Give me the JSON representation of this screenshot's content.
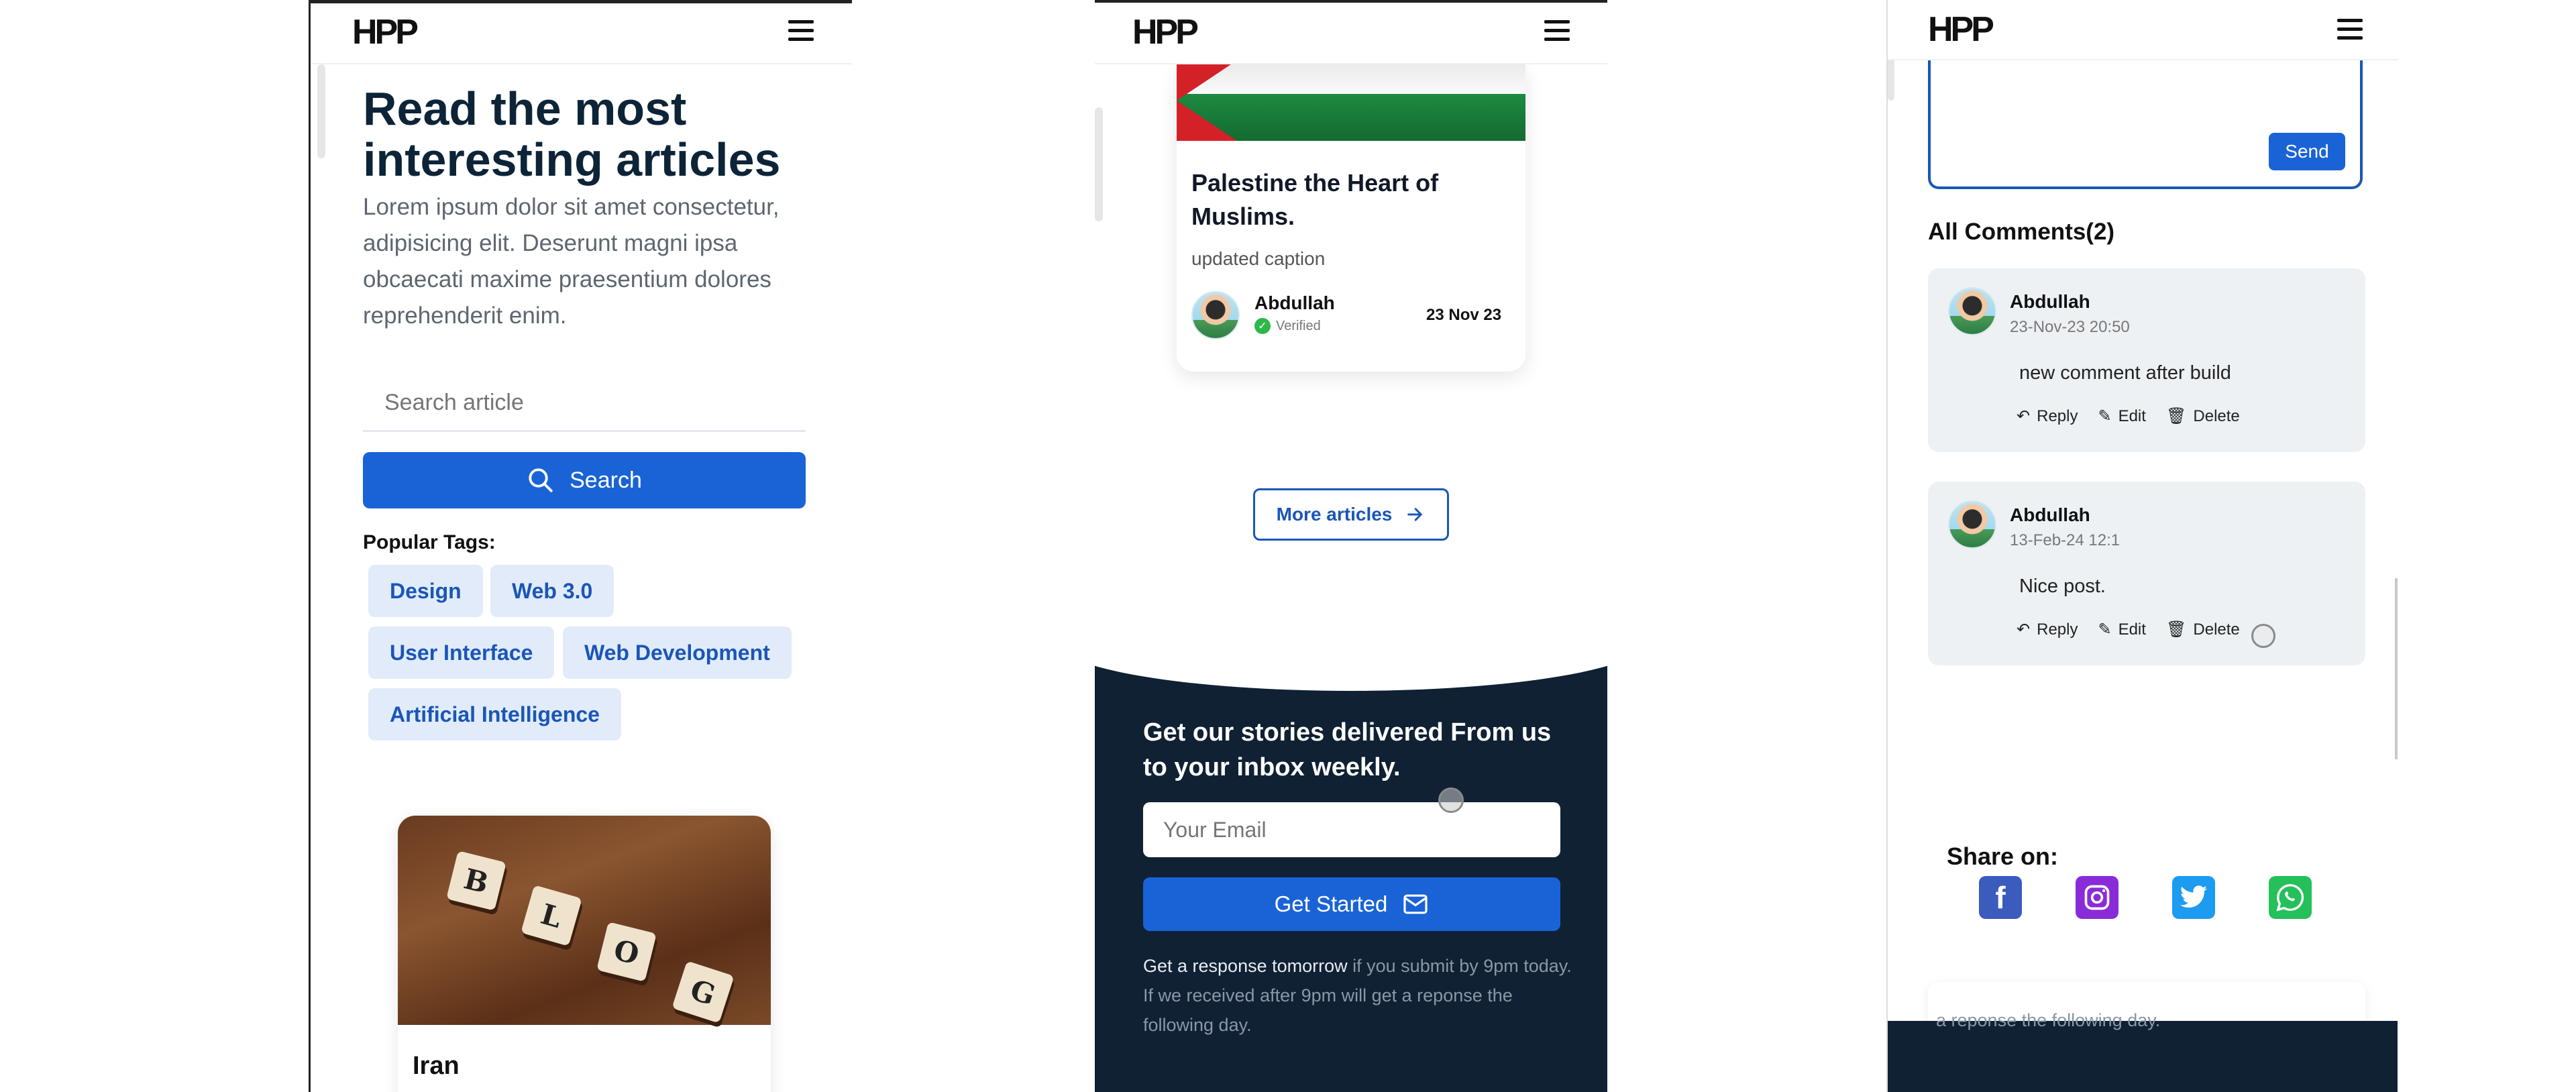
{
  "brand": {
    "logo": "HPP"
  },
  "phone1": {
    "hero_title": "Read the most interesting articles",
    "hero_text": "Lorem ipsum dolor sit amet consectetur, adipisicing elit. Deserunt magni ipsa obcaecati maxime praesentium dolores reprehenderit enim.",
    "search": {
      "placeholder": "Search article",
      "button_label": "Search"
    },
    "popular_tags_label": "Popular Tags:",
    "tags": [
      "Design",
      "Web 3.0",
      "User Interface",
      "Web Development",
      "Artificial Intelligence"
    ],
    "blog_tiles": [
      "B",
      "L",
      "O",
      "G"
    ],
    "card_title": "Iran"
  },
  "phone2": {
    "article": {
      "title": "Palestine the Heart of Muslims.",
      "caption": "updated caption",
      "author": "Abdullah",
      "verified_label": "Verified",
      "date": "23 Nov 23"
    },
    "more_articles_label": "More articles",
    "newsletter": {
      "title": "Get our stories delivered From us to your inbox weekly.",
      "email_placeholder": "Your Email",
      "button_label": "Get Started",
      "response_strong": "Get a response tomorrow",
      "response_rest": " if you submit by 9pm today. If we received after 9pm will get a reponse the following day."
    }
  },
  "phone3": {
    "send_label": "Send",
    "comments_heading": "All Comments(2)",
    "comments": [
      {
        "author": "Abdullah",
        "date": "23-Nov-23 20:50",
        "text": "new comment after build"
      },
      {
        "author": "Abdullah",
        "date": "13-Feb-24 12:1",
        "text": "Nice post."
      }
    ],
    "actions": {
      "reply": "Reply",
      "edit": "Edit",
      "delete": "Delete"
    },
    "share_label": "Share on:",
    "social": [
      "facebook-icon",
      "instagram-icon",
      "twitter-icon",
      "whatsapp-icon"
    ],
    "footer_text": "a reponse the following day."
  },
  "colors": {
    "primary": "#1a63d6",
    "dark_navy": "#0f2133",
    "tag_bg": "#e1ebfa",
    "facebook": "#3b5bbd",
    "instagram": "#8a2bd8",
    "twitter": "#1d9bf0",
    "whatsapp": "#25c05a"
  }
}
